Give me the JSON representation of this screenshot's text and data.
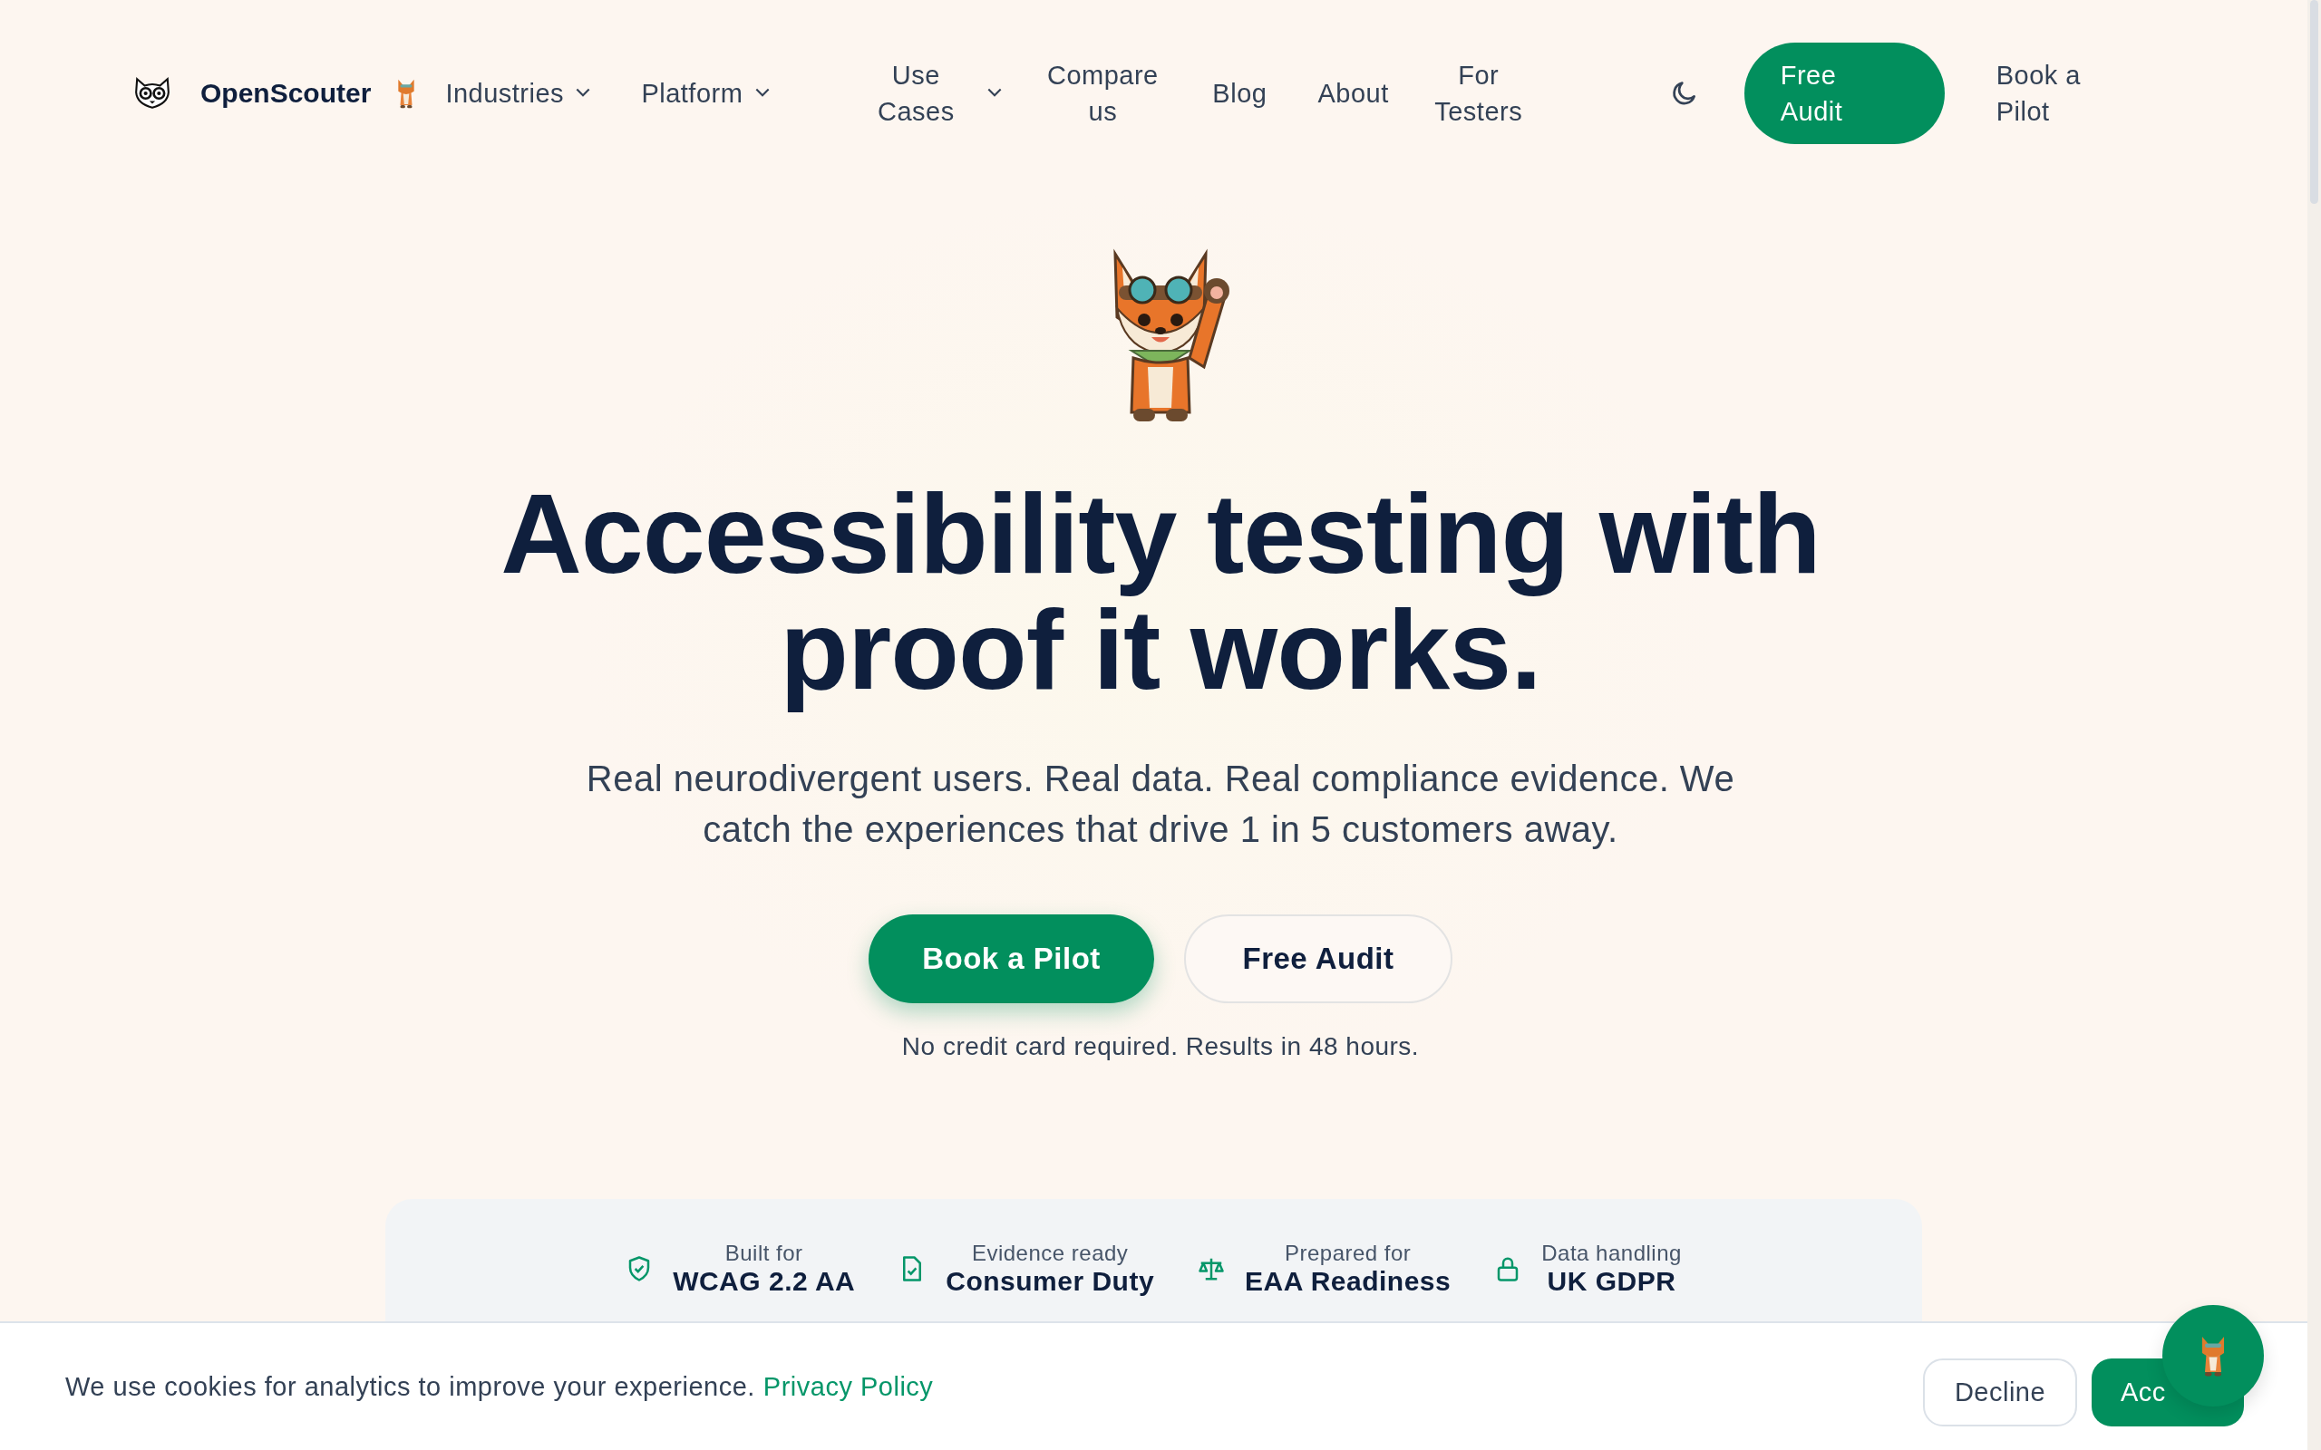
{
  "nav": {
    "brand": "OpenScouter",
    "items": [
      {
        "label": "Industries",
        "dropdown": true
      },
      {
        "label": "Platform",
        "dropdown": true
      },
      {
        "label": "Use Cases",
        "dropdown": true
      },
      {
        "label": "Compare us",
        "dropdown": false
      },
      {
        "label": "Blog",
        "dropdown": false
      },
      {
        "label": "About",
        "dropdown": false
      },
      {
        "label": "For Testers",
        "dropdown": false
      }
    ],
    "primary_button": "Free Audit",
    "secondary_link": "Book a Pilot"
  },
  "hero": {
    "headline": "Accessibility testing with proof it works.",
    "subtitle": "Real neurodivergent users. Real data. Real compliance evidence. We catch the experiences that drive 1 in 5 customers away.",
    "primary_button": "Book a Pilot",
    "secondary_button": "Free Audit",
    "note": "No credit card required. Results in 48 hours."
  },
  "trust_items": [
    {
      "kind": "shield",
      "caption": "Built for",
      "value": "WCAG 2.2 AA"
    },
    {
      "kind": "document",
      "caption": "Evidence ready",
      "value": "Consumer Duty"
    },
    {
      "kind": "scales",
      "caption": "Prepared for",
      "value": "EAA Readiness"
    },
    {
      "kind": "lock",
      "caption": "Data handling",
      "value": "UK GDPR"
    }
  ],
  "cookie_banner": {
    "message": "We use cookies for analytics to improve your experience.",
    "link": "Privacy Policy",
    "decline": "Decline",
    "accept": "Acc"
  }
}
